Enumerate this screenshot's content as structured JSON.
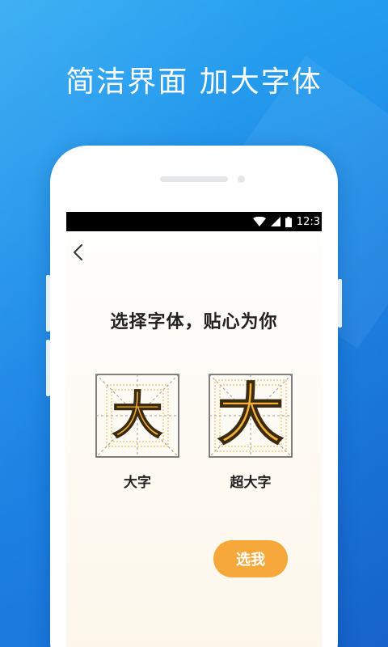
{
  "headline": "简洁界面 加大字体",
  "status_bar": {
    "time": "12:3",
    "icons": [
      "wifi-icon",
      "signal-icon",
      "battery-icon"
    ]
  },
  "screen": {
    "back_icon": "chevron-left-icon",
    "title": "选择字体，贴心为你",
    "options": [
      {
        "glyph": "大",
        "label": "大字"
      },
      {
        "glyph": "大",
        "label": "超大字"
      }
    ],
    "choose_button": "选我"
  },
  "colors": {
    "background": "#1e8be8",
    "accent": "#f6a93a",
    "glyph_fill": "#f8b132",
    "grid_dashed": "#9a9a9a",
    "grid_dotted": "#f0b23a"
  }
}
